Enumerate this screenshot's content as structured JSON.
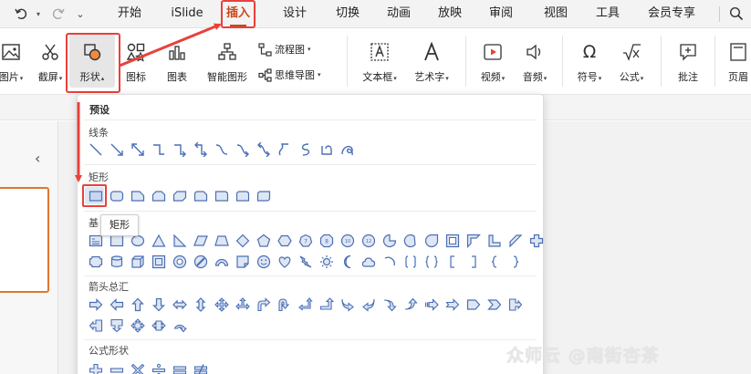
{
  "menubar": {
    "tabs": [
      "开始",
      "iSlide",
      "插入",
      "设计",
      "切换",
      "动画",
      "放映",
      "审阅",
      "视图",
      "工具",
      "会员专享"
    ],
    "active_tab": "插入"
  },
  "ribbon": {
    "picture_label": "图片",
    "screenshot_label": "截屏",
    "shape_label": "形状",
    "icon_label": "图标",
    "chart_label": "图表",
    "smartart_label": "智能图形",
    "flowchart_label": "流程图",
    "mindmap_label": "思维导图",
    "textbox_label": "文本框",
    "wordart_label": "艺术字",
    "video_label": "视频",
    "audio_label": "音频",
    "symbol_label": "符号",
    "formula_label": "公式",
    "comment_label": "批注",
    "header_label": "页眉"
  },
  "panel": {
    "title": "预设",
    "sections": {
      "lines": "线条",
      "rectangles": "矩形",
      "basic": "基",
      "arrows": "箭头总汇",
      "equation": "公式形状"
    },
    "tooltip": "矩形"
  },
  "watermark": "众师云 @南街杏茶",
  "colors": {
    "accent": "#c8471b",
    "highlight_red": "#e8413a",
    "shape_stroke": "#4a6fb5",
    "shape_fill": "#dfe6f3"
  }
}
